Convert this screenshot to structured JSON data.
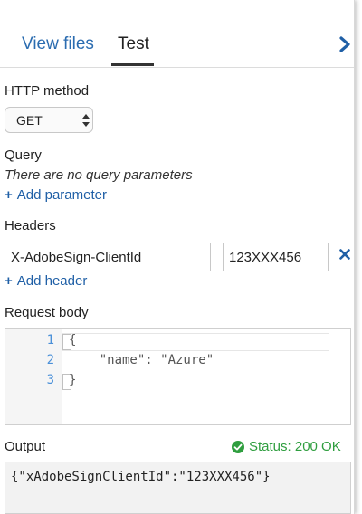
{
  "tabs": {
    "view_files": "View files",
    "test": "Test"
  },
  "http_method": {
    "label": "HTTP method",
    "selected": "GET"
  },
  "query": {
    "label": "Query",
    "empty_text": "There are no query parameters",
    "add_label": "Add parameter"
  },
  "headers": {
    "label": "Headers",
    "rows": [
      {
        "name": "X-AdobeSign-ClientId",
        "value": "123XXX456"
      }
    ],
    "add_label": "Add header"
  },
  "request_body": {
    "label": "Request body",
    "line_numbers": [
      "1",
      "2",
      "3"
    ],
    "lines": [
      "{",
      "    \"name\": \"Azure\"",
      "}"
    ]
  },
  "output": {
    "label": "Output",
    "status": "Status: 200 OK",
    "body": "{\"xAdobeSignClientId\":\"123XXX456\"}"
  },
  "colors": {
    "link": "#1f5fa6",
    "tab_link": "#2b6cb0",
    "success": "#2f9e3f",
    "line_number": "#4a90d9"
  }
}
